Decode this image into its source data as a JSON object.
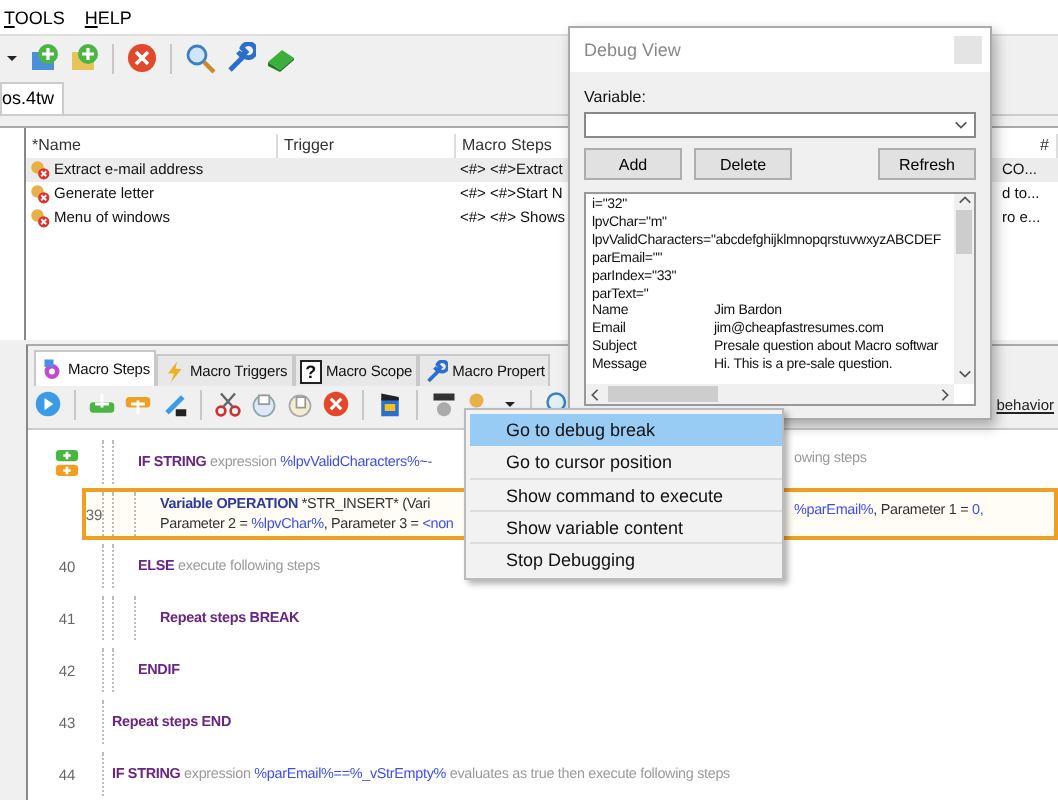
{
  "menu": [
    "TOOLS",
    "HELP"
  ],
  "file_tab": "os.4tw",
  "macro_table": {
    "columns": [
      "*Name",
      "Trigger",
      "Macro Steps",
      "#"
    ],
    "rows": [
      {
        "name": "Extract e-mail address",
        "steps": "<#> <#>Extract",
        "column_4": "CO...",
        "selected": true
      },
      {
        "name": "Generate letter",
        "steps": "<#> <#>Start N",
        "column_4": "d to...",
        "selected": false
      },
      {
        "name": "Menu of windows",
        "steps": "<#> <#> Shows",
        "column_4": "ro e...",
        "selected": false
      }
    ]
  },
  "lower_tabs": [
    {
      "label": "Macro Steps",
      "selected": true
    },
    {
      "label": "Macro Triggers",
      "selected": false
    },
    {
      "label": "Macro Scope",
      "icon_text": "?",
      "selected": false
    },
    {
      "label": "Macro Propert",
      "selected": false
    }
  ],
  "behavior_link": "behavior",
  "steps": [
    {
      "kind": "block",
      "children": [
        {
          "kind": "step",
          "selected": false,
          "left": [
            [
              {
                "text": "IF STRING",
                "kind": "keyword"
              },
              {
                "text": " expression ",
                "kind": "hint"
              },
              {
                "text": "%lpvValidCharacters%~-",
                "kind": "var"
              }
            ]
          ],
          "right": [
            [
              {
                "text": "owing steps",
                "kind": "hint"
              }
            ]
          ],
          "children": [
            {
              "kind": "step",
              "number": "39",
              "selected": true,
              "left": [
                [
                  {
                    "text": "Variable OPERATION",
                    "kind": "command"
                  },
                  {
                    "text": " *STR_INSERT* (Vari",
                    "kind": "text"
                  }
                ],
                [
                  {
                    "text": "Parameter 2 = ",
                    "kind": "text"
                  },
                  {
                    "text": "%lpvChar%",
                    "kind": "var"
                  },
                  {
                    "text": ", Parameter 3 = ",
                    "kind": "text"
                  },
                  {
                    "text": "<non",
                    "kind": "var"
                  }
                ]
              ],
              "right": [
                [
                  {
                    "text": "%parEmail%",
                    "kind": "var"
                  },
                  {
                    "text": ", Parameter 1 = ",
                    "kind": "text"
                  },
                  {
                    "text": "0,",
                    "kind": "var"
                  }
                ]
              ]
            }
          ]
        },
        {
          "kind": "step",
          "number": "40",
          "selected": false,
          "left": [
            [
              {
                "text": "ELSE",
                "kind": "keyword"
              },
              {
                "text": " execute following steps",
                "kind": "hint"
              }
            ]
          ],
          "children": [
            {
              "kind": "step",
              "number": "41",
              "selected": false,
              "left": [
                [
                  {
                    "text": "Repeat steps BREAK",
                    "kind": "keyword"
                  }
                ]
              ]
            }
          ]
        },
        {
          "kind": "step",
          "number": "42",
          "selected": false,
          "left": [
            [
              {
                "text": "ENDIF",
                "kind": "keyword"
              }
            ]
          ]
        }
      ]
    },
    {
      "kind": "step",
      "number": "43",
      "selected": false,
      "left": [
        [
          {
            "text": "Repeat steps END",
            "kind": "keyword"
          }
        ]
      ]
    },
    {
      "kind": "step",
      "number": "44",
      "selected": false,
      "left": [
        [
          {
            "text": "IF STRING",
            "kind": "keyword"
          },
          {
            "text": " expression ",
            "kind": "hint"
          },
          {
            "text": "%parEmail%==%_vStrEmpty%",
            "kind": "var"
          },
          {
            "text": " evaluates as true then execute following steps",
            "kind": "hint"
          }
        ]
      ]
    }
  ],
  "debug_menu": [
    {
      "label": "Go to debug break",
      "selected": true
    },
    {
      "label": "Go to cursor position",
      "selected": false
    },
    {
      "label": "Show command to execute",
      "selected": false
    },
    {
      "label": "Show variable content",
      "selected": false
    },
    {
      "label": "Stop Debugging",
      "selected": false
    }
  ],
  "debug_view": {
    "title": "Debug View",
    "variable_label": "Variable:",
    "buttons": [
      "Add",
      "Delete",
      "Refresh"
    ],
    "lines": [
      {
        "kind": "assignment",
        "text": "i=\"32\""
      },
      {
        "kind": "assignment",
        "text": "lpvChar=\"m\""
      },
      {
        "kind": "assignment",
        "text": "lpvValidCharacters=\"abcdefghijklmnopqrstuvwxyzABCDEF"
      },
      {
        "kind": "assignment",
        "text": "parEmail=\"\""
      },
      {
        "kind": "assignment",
        "text": "parIndex=\"33\""
      },
      {
        "kind": "assignment",
        "text": "parText=\""
      },
      {
        "kind": "field",
        "key": "Name",
        "value": "Jim Bardon"
      },
      {
        "kind": "field",
        "key": "Email",
        "value": "jim@cheapfastresumes.com"
      },
      {
        "kind": "field",
        "key": "Subject",
        "value": "Presale question about Macro softwar"
      },
      {
        "kind": "field",
        "key": "Message",
        "value": "Hi. This is a pre-sale question."
      }
    ]
  }
}
